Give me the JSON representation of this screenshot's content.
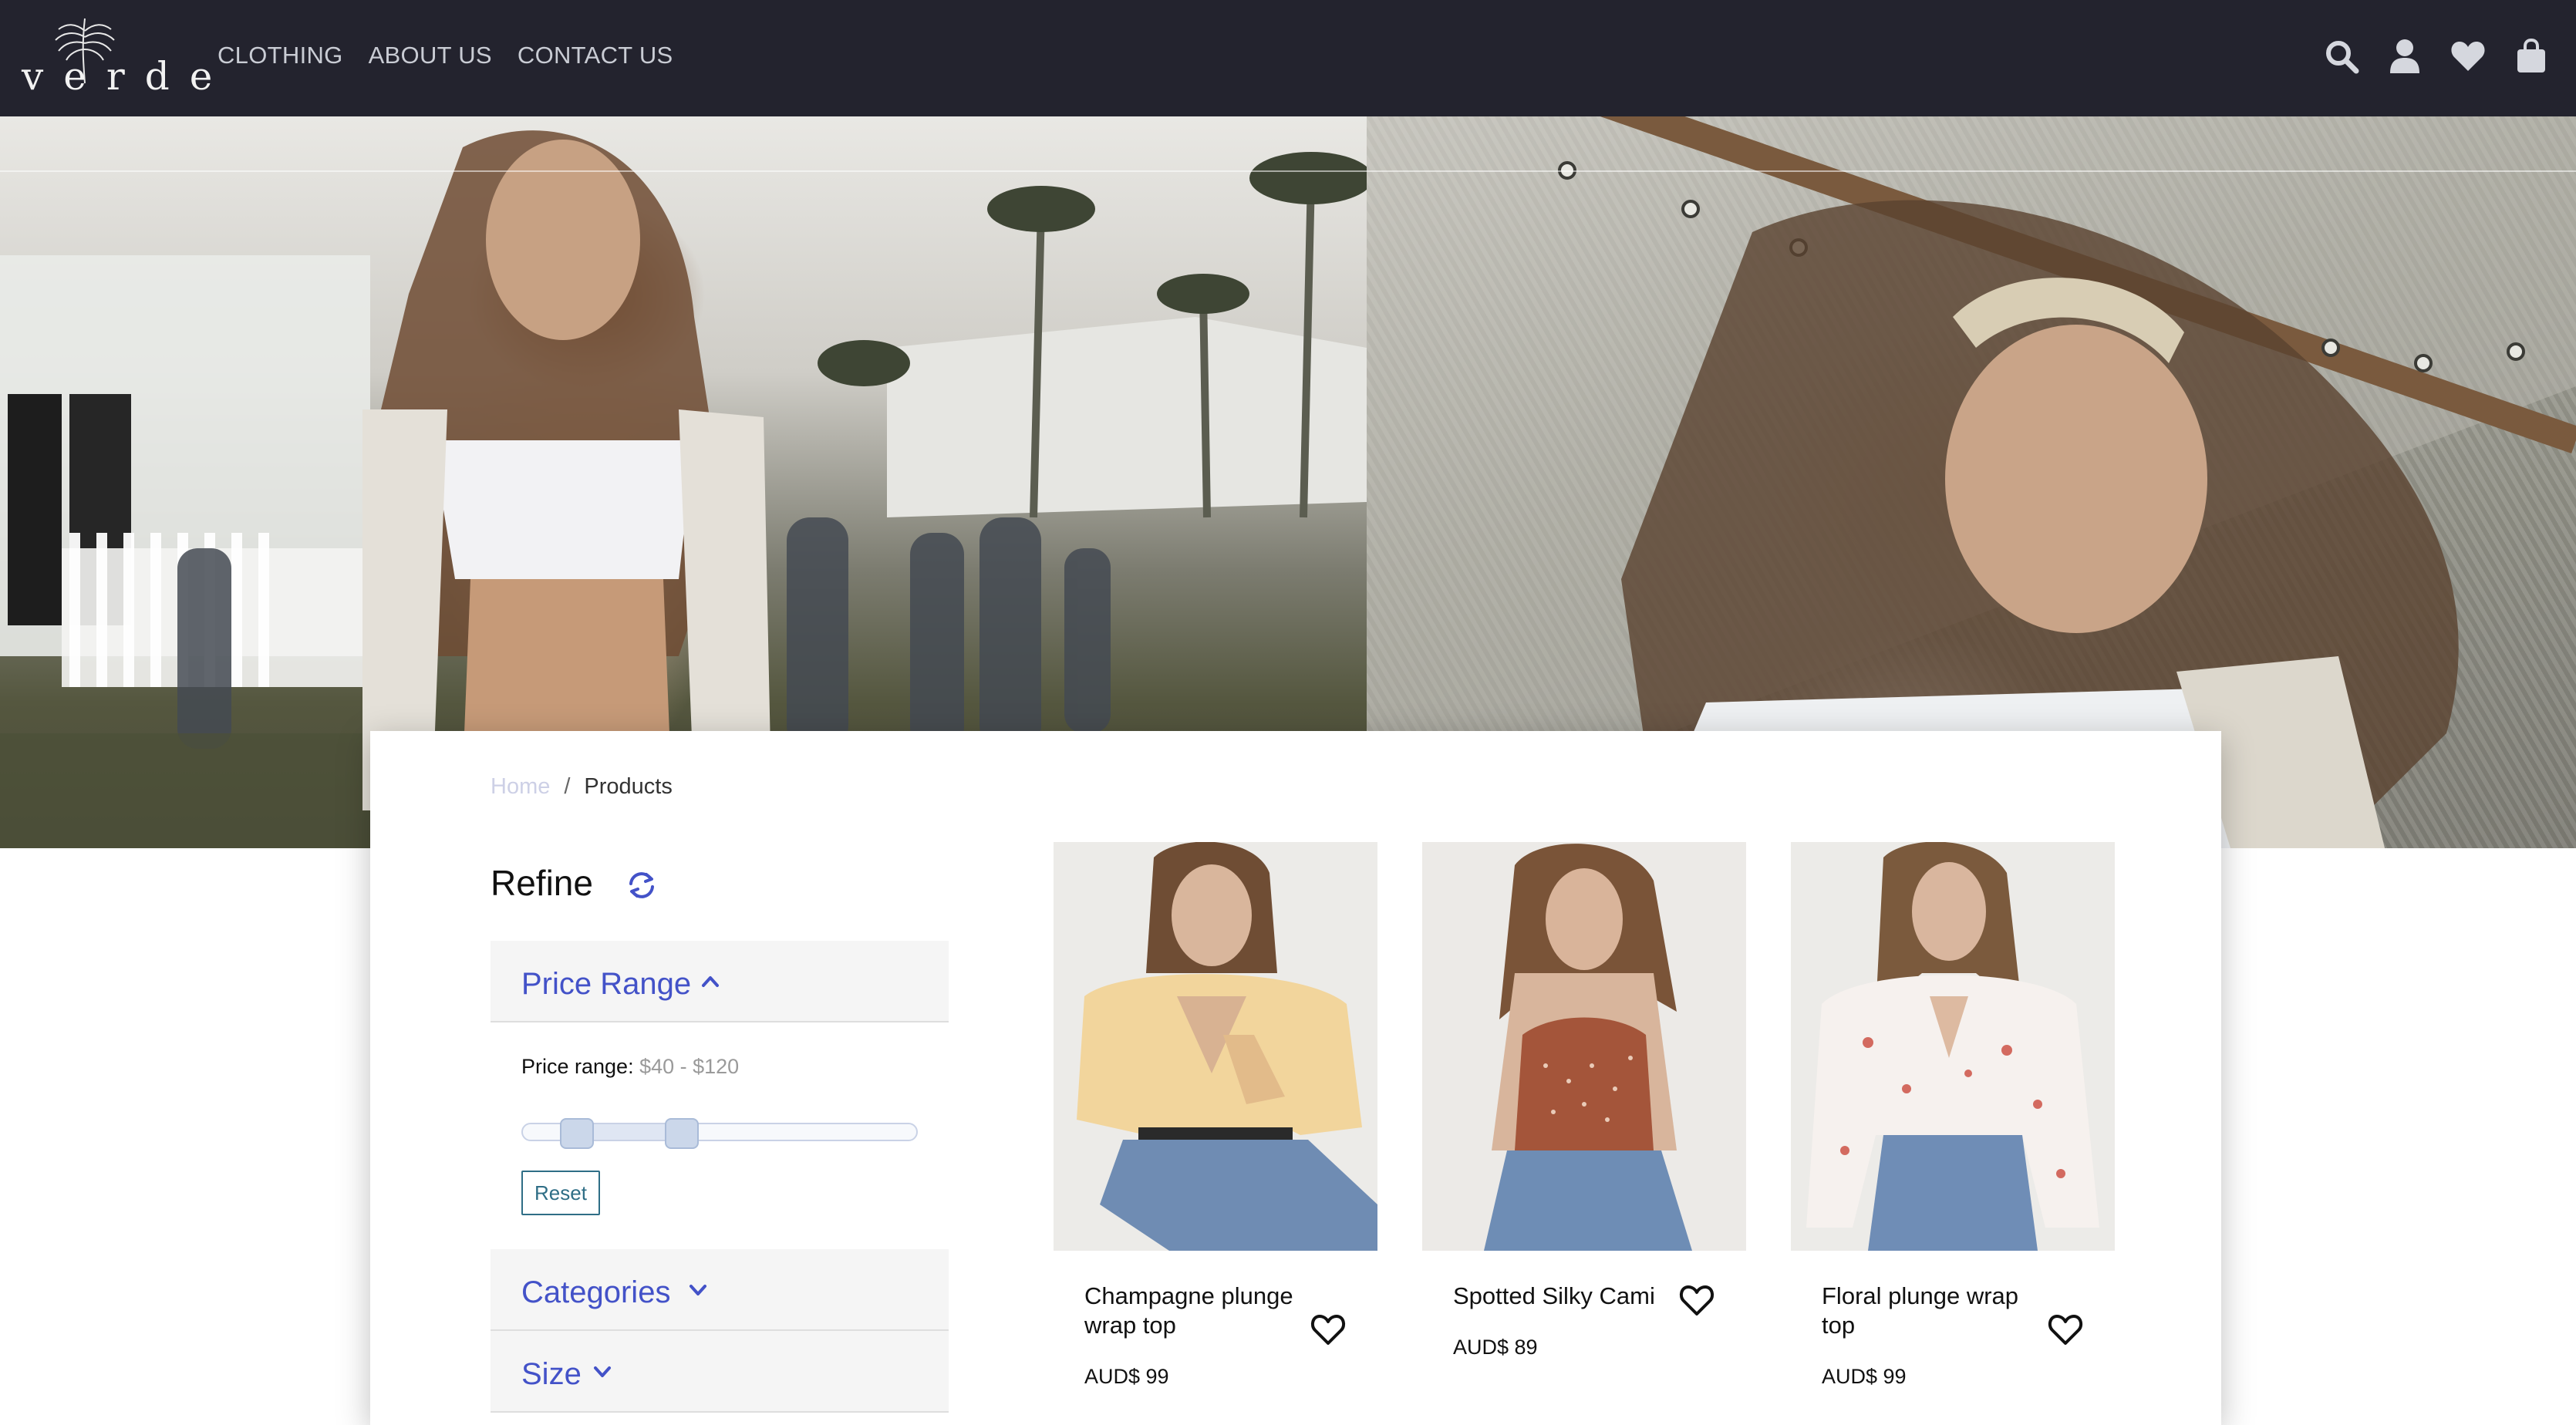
{
  "brand": {
    "name": "verde"
  },
  "nav": {
    "links": [
      "CLOTHING",
      "ABOUT US",
      "CONTACT US"
    ],
    "icons": [
      "search-icon",
      "user-icon",
      "heart-icon",
      "shopping-bag-icon"
    ]
  },
  "breadcrumb": {
    "home": "Home",
    "separator": "/",
    "current": "Products"
  },
  "refine": {
    "title": "Refine",
    "reset_icon": "refresh-icon",
    "price_range": {
      "header": "Price Range",
      "expanded": true,
      "label": "Price range:",
      "value": "$40 - $120",
      "min": 40,
      "max": 120,
      "reset_label": "Reset"
    },
    "categories": {
      "header": "Categories",
      "expanded": false
    },
    "size": {
      "header": "Size",
      "expanded": false
    }
  },
  "products": [
    {
      "name": "Champagne plunge wrap top",
      "price": "AUD$ 99",
      "wishlist_icon": "heart-outline-icon"
    },
    {
      "name": "Spotted Silky Cami",
      "price": "AUD$ 89",
      "wishlist_icon": "heart-outline-icon"
    },
    {
      "name": "Floral plunge wrap top",
      "price": "AUD$ 99",
      "wishlist_icon": "heart-outline-icon"
    }
  ],
  "colors": {
    "navbar": "#23232e",
    "nav_text": "#c9ccd4",
    "accent": "#4352c8",
    "reset_button": "#2f6e86",
    "filter_header_bg": "#f5f5f5"
  }
}
